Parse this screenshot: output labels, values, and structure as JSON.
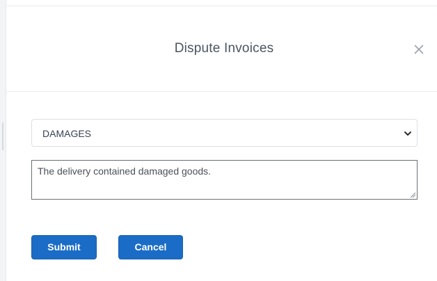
{
  "modal": {
    "title": "Dispute Invoices",
    "close_icon": "close-icon"
  },
  "form": {
    "reason_select": {
      "value": "DAMAGES",
      "icon": "chevron-down-icon"
    },
    "comment": {
      "value": "The delivery contained damaged goods."
    }
  },
  "actions": {
    "submit_label": "Submit",
    "cancel_label": "Cancel"
  },
  "colors": {
    "primary_button": "#1b6cc6",
    "title_text": "#4a5560",
    "divider": "#e9ecef"
  }
}
